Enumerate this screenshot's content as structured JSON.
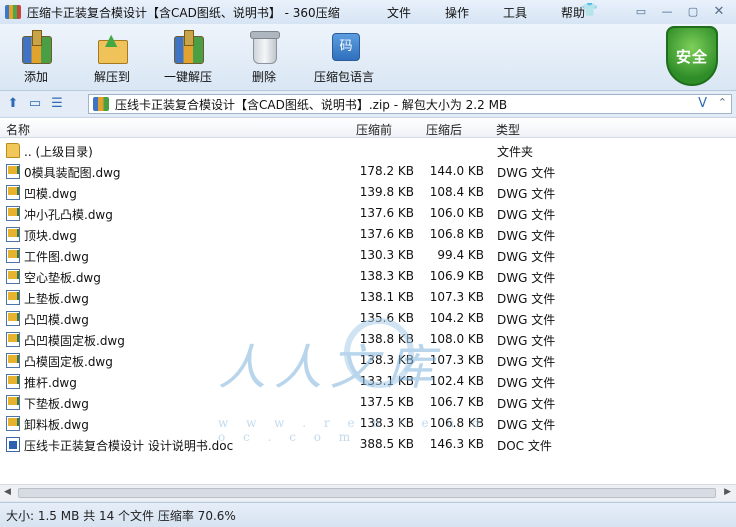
{
  "window": {
    "title": "压缩卡正装复合模设计【含CAD图纸、说明书】 - 360压缩"
  },
  "menu": [
    "文件",
    "操作",
    "工具",
    "帮助"
  ],
  "window_controls": {
    "skin": "👕",
    "menu_icon": "▭",
    "minimize": "—",
    "restore": "▢",
    "close": "✕"
  },
  "toolbar": [
    {
      "icon": "add-icon",
      "label": "添加"
    },
    {
      "icon": "extract-to-icon",
      "label": "解压到"
    },
    {
      "icon": "one-click-extract-icon",
      "label": "一键解压"
    },
    {
      "icon": "delete-icon",
      "label": "删除"
    },
    {
      "icon": "language-icon",
      "label": "压缩包语言"
    }
  ],
  "security_badge": "安全",
  "address": {
    "text": "压线卡正装复合模设计【含CAD图纸、说明书】.zip - 解包大小为 2.2 MB",
    "dropdown": "V",
    "up": "⌃"
  },
  "columns": {
    "name": "名称",
    "compressed": "压缩前",
    "after": "压缩后",
    "type": "类型"
  },
  "files": [
    {
      "icon": "folder",
      "name": ".. (上级目录)",
      "before": "",
      "after": "",
      "type": "文件夹"
    },
    {
      "icon": "dwg",
      "name": "0模具装配图.dwg",
      "before": "178.2 KB",
      "after": "144.0 KB",
      "type": "DWG 文件"
    },
    {
      "icon": "dwg",
      "name": "凹模.dwg",
      "before": "139.8 KB",
      "after": "108.4 KB",
      "type": "DWG 文件"
    },
    {
      "icon": "dwg",
      "name": "冲小孔凸模.dwg",
      "before": "137.6 KB",
      "after": "106.0 KB",
      "type": "DWG 文件"
    },
    {
      "icon": "dwg",
      "name": "顶块.dwg",
      "before": "137.6 KB",
      "after": "106.8 KB",
      "type": "DWG 文件"
    },
    {
      "icon": "dwg",
      "name": "工件图.dwg",
      "before": "130.3 KB",
      "after": "99.4 KB",
      "type": "DWG 文件"
    },
    {
      "icon": "dwg",
      "name": "空心垫板.dwg",
      "before": "138.3 KB",
      "after": "106.9 KB",
      "type": "DWG 文件"
    },
    {
      "icon": "dwg",
      "name": "上垫板.dwg",
      "before": "138.1 KB",
      "after": "107.3 KB",
      "type": "DWG 文件"
    },
    {
      "icon": "dwg",
      "name": "凸凹模.dwg",
      "before": "135.6 KB",
      "after": "104.2 KB",
      "type": "DWG 文件"
    },
    {
      "icon": "dwg",
      "name": "凸凹模固定板.dwg",
      "before": "138.8 KB",
      "after": "108.0 KB",
      "type": "DWG 文件"
    },
    {
      "icon": "dwg",
      "name": "凸模固定板.dwg",
      "before": "138.3 KB",
      "after": "107.3 KB",
      "type": "DWG 文件"
    },
    {
      "icon": "dwg",
      "name": "推杆.dwg",
      "before": "133.1 KB",
      "after": "102.4 KB",
      "type": "DWG 文件"
    },
    {
      "icon": "dwg",
      "name": "下垫板.dwg",
      "before": "137.5 KB",
      "after": "106.7 KB",
      "type": "DWG 文件"
    },
    {
      "icon": "dwg",
      "name": "卸料板.dwg",
      "before": "138.3 KB",
      "after": "106.8 KB",
      "type": "DWG 文件"
    },
    {
      "icon": "doc",
      "name": "压线卡正装复合模设计 设计说明书.doc",
      "before": "388.5 KB",
      "after": "146.3 KB",
      "type": "DOC 文件"
    }
  ],
  "watermark": {
    "text": "人人文库",
    "url": "w w w . r e n r e n d o c . c o m"
  },
  "status": "大小: 1.5 MB 共 14 个文件 压缩率 70.6%"
}
